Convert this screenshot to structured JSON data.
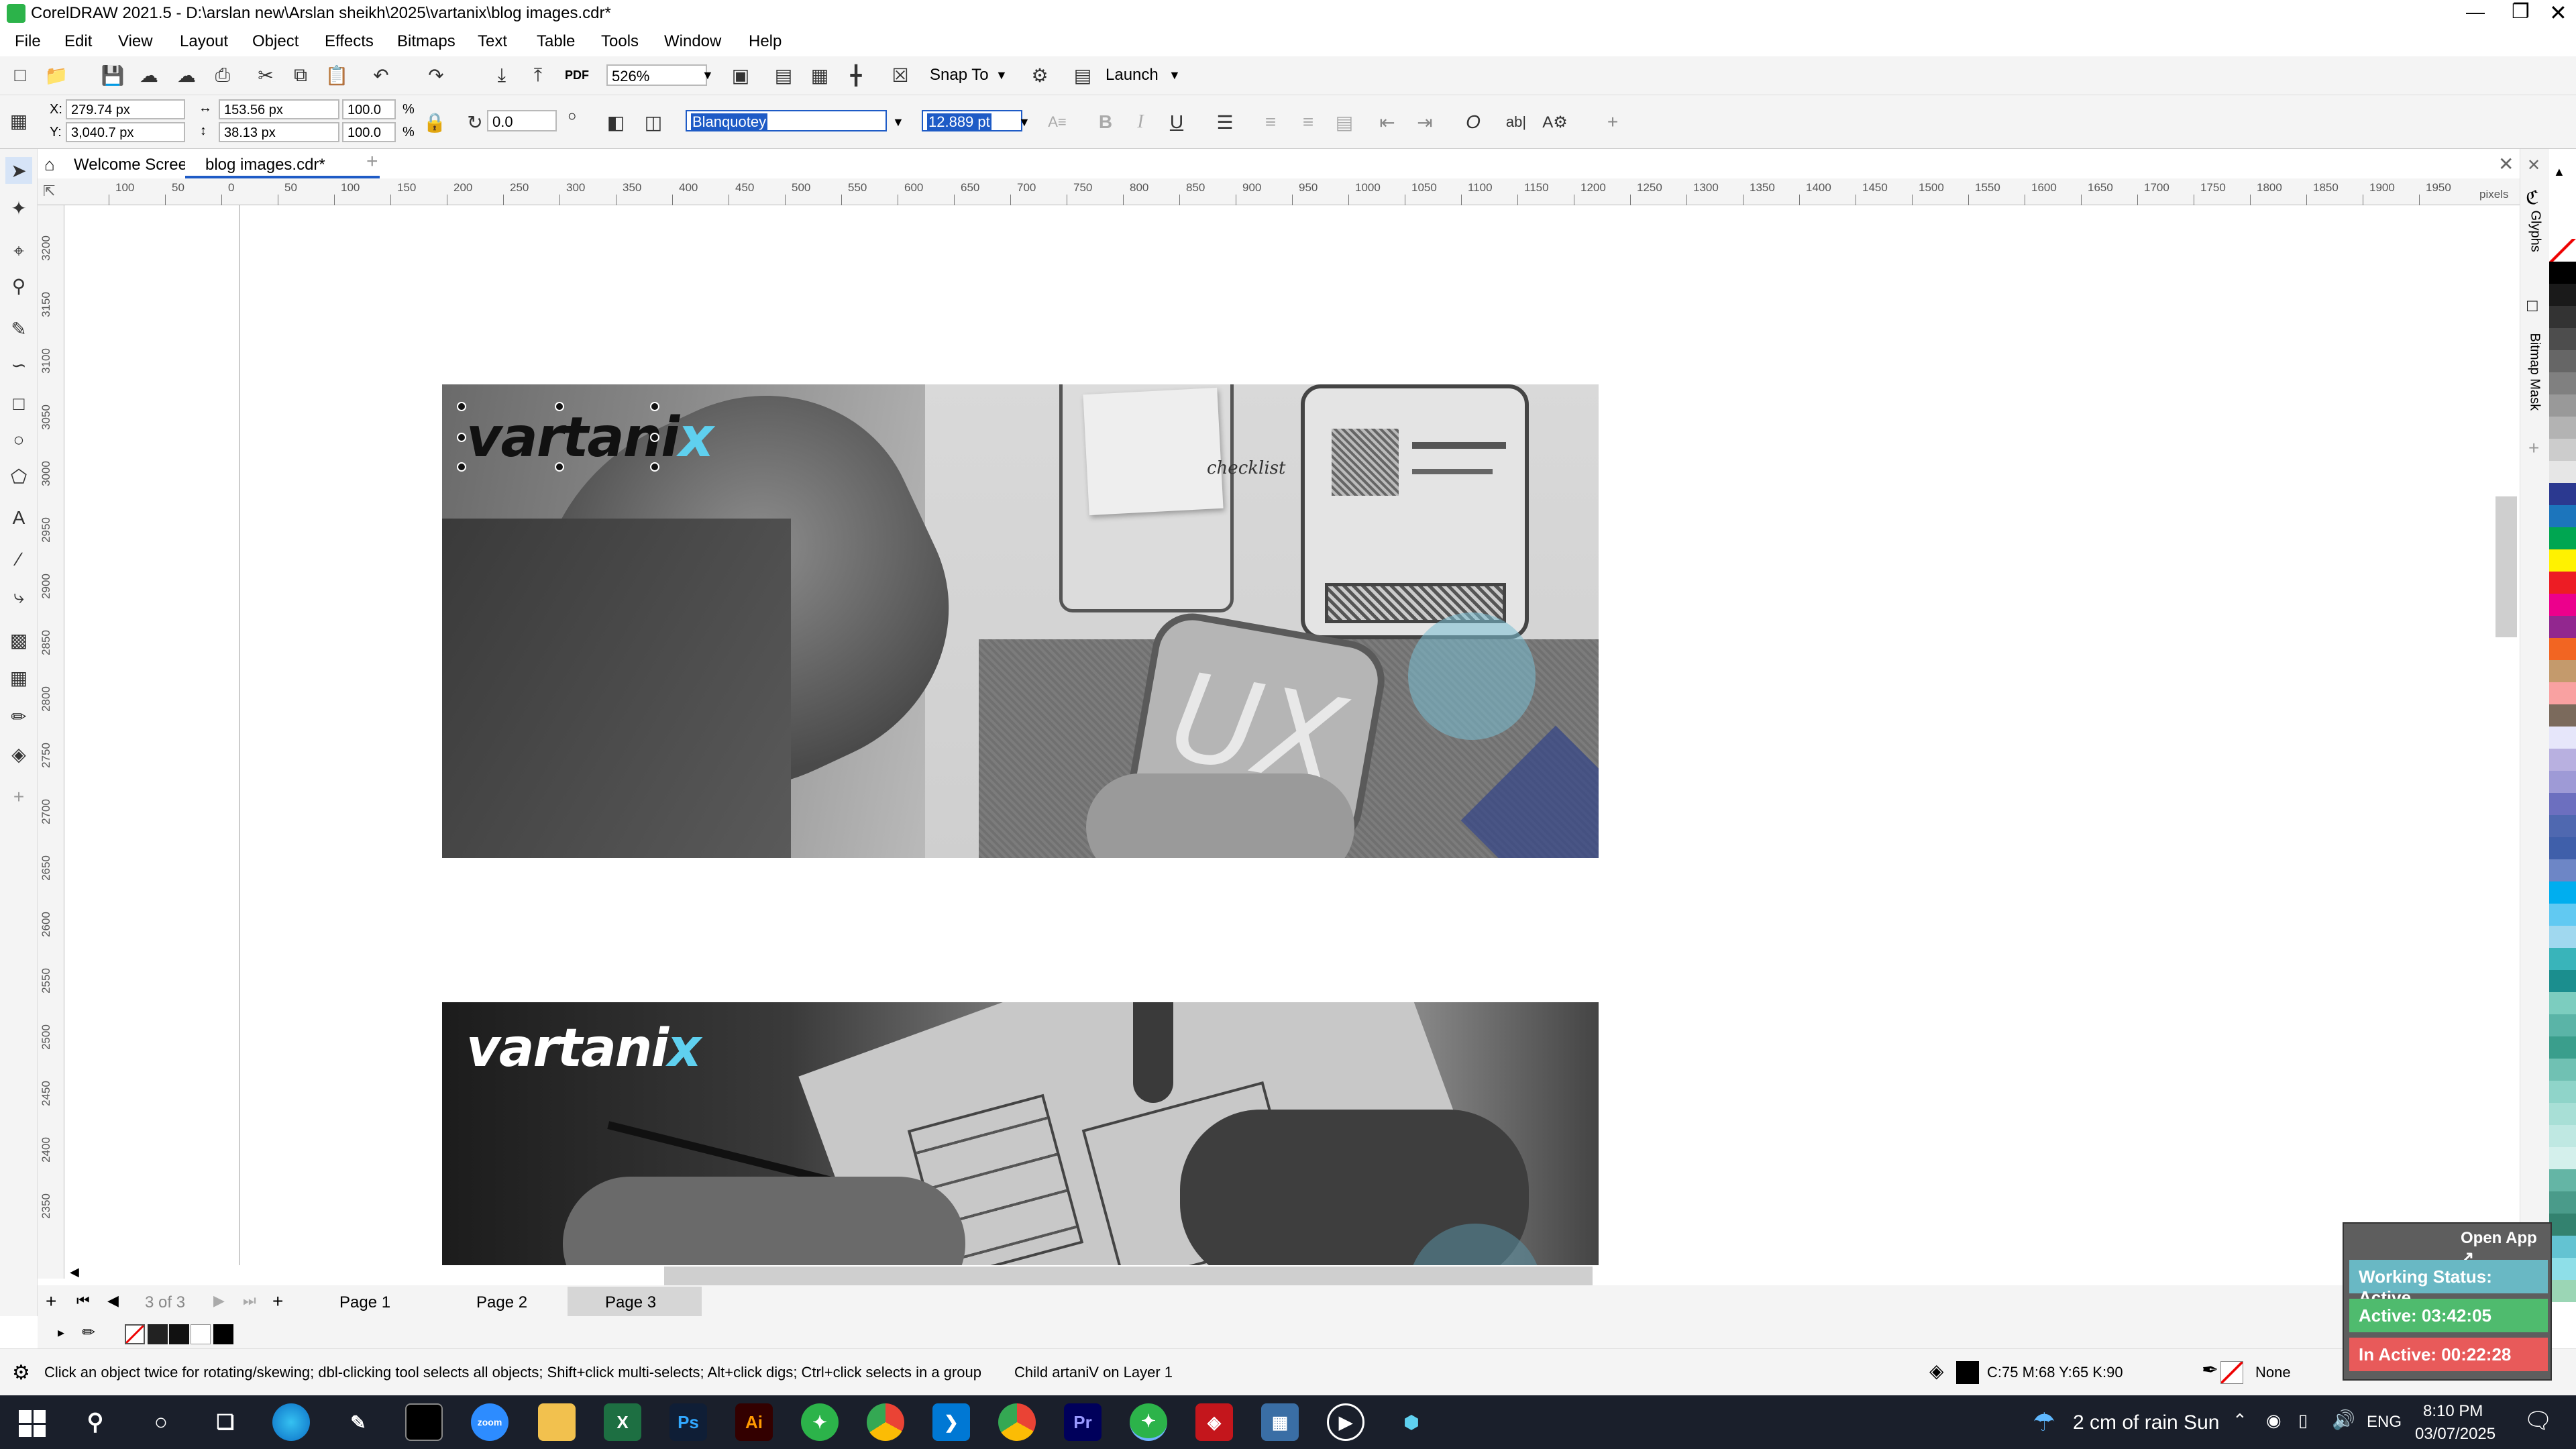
{
  "window": {
    "title": "CorelDRAW 2021.5 - D:\\arslan new\\Arslan sheikh\\2025\\vartanix\\blog images.cdr*"
  },
  "menu": [
    "File",
    "Edit",
    "View",
    "Layout",
    "Object",
    "Effects",
    "Bitmaps",
    "Text",
    "Table",
    "Tools",
    "Window",
    "Help"
  ],
  "toolbar": {
    "zoom": "526%",
    "snap_label": "Snap To",
    "launch_label": "Launch",
    "pdf_label": "PDF"
  },
  "props": {
    "x": "279.74 px",
    "y": "3,040.7 px",
    "w": "153.56 px",
    "h": "38.13 px",
    "scale_w": "100.0",
    "scale_h": "100.0",
    "pct": "%",
    "rotation": "0.0",
    "font": "Blanquotey",
    "size": "12.889 pt"
  },
  "tabs": [
    {
      "label": "Welcome Screen"
    },
    {
      "label": "blog images.cdr*"
    }
  ],
  "ruler": {
    "h_ticks": [
      "100",
      "50",
      "0",
      "50",
      "100",
      "150",
      "200",
      "250",
      "300",
      "350",
      "400",
      "450",
      "500",
      "550",
      "600",
      "650",
      "700",
      "750",
      "800",
      "850",
      "900",
      "950",
      "1000",
      "1050",
      "1100",
      "1150",
      "1200",
      "1250",
      "1300",
      "1350",
      "1400",
      "1450",
      "1500",
      "1550",
      "1600",
      "1650",
      "1700",
      "1750",
      "1800",
      "1850",
      "1900",
      "1950"
    ],
    "unit": "pixels",
    "v_ticks": [
      "3200",
      "3150",
      "3100",
      "3050",
      "3000",
      "2950",
      "2900",
      "2850",
      "2800",
      "2750",
      "2700",
      "2650",
      "2600",
      "2550",
      "2500",
      "2450",
      "2400",
      "2350"
    ]
  },
  "canvas": {
    "logo_text": "vartani",
    "logo_x": "x",
    "ux_text": "UX",
    "checklist": "checklist"
  },
  "pages": {
    "counter": "3 of 3",
    "items": [
      "Page 1",
      "Page 2",
      "Page 3"
    ],
    "active": "Page 3"
  },
  "status": {
    "hint": "Click an object twice for rotating/skewing; dbl-clicking tool selects all objects; Shift+click multi-selects; Alt+click digs; Ctrl+click selects in a group",
    "object": "Child artaniV on Layer 1",
    "fill": "C:75 M:68 Y:65 K:90",
    "outline": "None"
  },
  "dock": {
    "glyphs": "Glyphs",
    "bitmap_mask": "Bitmap Mask"
  },
  "widget": {
    "open_app": "Open App ↗",
    "working": "Working Status: Active",
    "active": "Active: 03:42:05",
    "inactive": "In Active: 00:22:28"
  },
  "taskbar": {
    "weather": "2 cm of rain Sun",
    "lang": "ENG",
    "time": "8:10 PM",
    "date": "03/07/2025"
  },
  "colors": {
    "accent": "#1e5bc6",
    "palette": [
      "#ffffff",
      "#000000",
      "#1a1a1a",
      "#333333",
      "#4d4d4d",
      "#666666",
      "#808080",
      "#999999",
      "#b3b3b3",
      "#cccccc",
      "#e6e6e6",
      "#2b3990",
      "#1c75bc",
      "#00a651",
      "#fff200",
      "#ed1c24",
      "#ec008c",
      "#92278f",
      "#f26522",
      "#c49a6c",
      "#f9a1a1",
      "#7b6a5c",
      "#e6e6fa",
      "#b8b0e0",
      "#9e9ad6",
      "#6c6fbf",
      "#4f68b0",
      "#3f5faa",
      "#6d86c6",
      "#00aeef",
      "#61c9f2",
      "#a0d8ef",
      "#39b4ba",
      "#1b8e8e",
      "#7ccdbf",
      "#5ab4a7",
      "#3a9e8c",
      "#70c1b3",
      "#8fd4c9",
      "#a8dfd6",
      "#bfe8e2",
      "#d4f0ec",
      "#64b5a5",
      "#4a9b8a",
      "#33826f",
      "#63c3d2",
      "#8edfe8",
      "#9bd6b5"
    ]
  }
}
